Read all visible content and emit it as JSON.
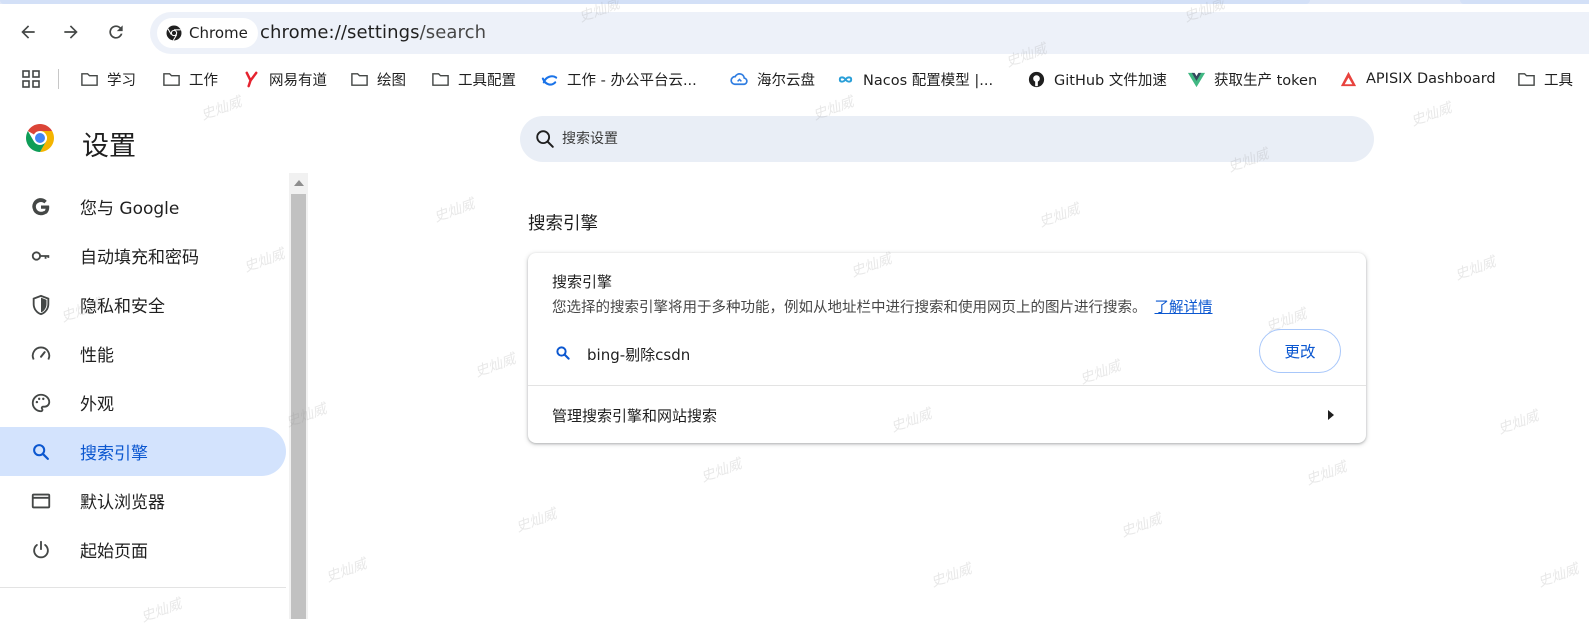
{
  "browser": {
    "chip_label": "Chrome",
    "url_host": "chrome://settings",
    "url_path": "/search"
  },
  "bookmarks": [
    {
      "label": "学习",
      "icon": "folder-icon"
    },
    {
      "label": "工作",
      "icon": "folder-icon"
    },
    {
      "label": "网易有道",
      "icon": "youdao-icon"
    },
    {
      "label": "绘图",
      "icon": "folder-icon"
    },
    {
      "label": "工具配置",
      "icon": "folder-icon"
    },
    {
      "label": "工作 - 办公平台云...",
      "icon": "cloud-office-icon"
    },
    {
      "label": "海尔云盘",
      "icon": "cloud-drive-icon"
    },
    {
      "label": "Nacos 配置模型 |...",
      "icon": "nacos-icon"
    },
    {
      "label": "GitHub 文件加速",
      "icon": "github-icon"
    },
    {
      "label": "获取生产 token",
      "icon": "vue-icon"
    },
    {
      "label": "APISIX Dashboard",
      "icon": "apisix-icon"
    },
    {
      "label": "工具",
      "icon": "folder-icon"
    }
  ],
  "settings": {
    "title": "设置",
    "search_placeholder": "搜索设置"
  },
  "sidenav": [
    {
      "label": "您与 Google",
      "icon": "google-icon",
      "active": false
    },
    {
      "label": "自动填充和密码",
      "icon": "key-icon",
      "active": false
    },
    {
      "label": "隐私和安全",
      "icon": "shield-icon",
      "active": false
    },
    {
      "label": "性能",
      "icon": "speedometer-icon",
      "active": false
    },
    {
      "label": "外观",
      "icon": "palette-icon",
      "active": false
    },
    {
      "label": "搜索引擎",
      "icon": "search-icon",
      "active": true
    },
    {
      "label": "默认浏览器",
      "icon": "browser-window-icon",
      "active": false
    },
    {
      "label": "起始页面",
      "icon": "power-icon",
      "active": false
    }
  ],
  "main": {
    "section_title": "搜索引擎",
    "card": {
      "title": "搜索引擎",
      "description": "您选择的搜索引擎将用于多种功能，例如从地址栏中进行搜索和使用网页上的图片进行搜索。",
      "learn_more": "了解详情",
      "engine_name": "bing-剔除csdn",
      "change_label": "更改",
      "manage_label": "管理搜索引擎和网站搜索"
    }
  },
  "watermark": "史灿威",
  "colors": {
    "accent": "#0b57d0",
    "active_bg": "#d3e3fd",
    "omnibox_bg": "#edf1f9"
  }
}
